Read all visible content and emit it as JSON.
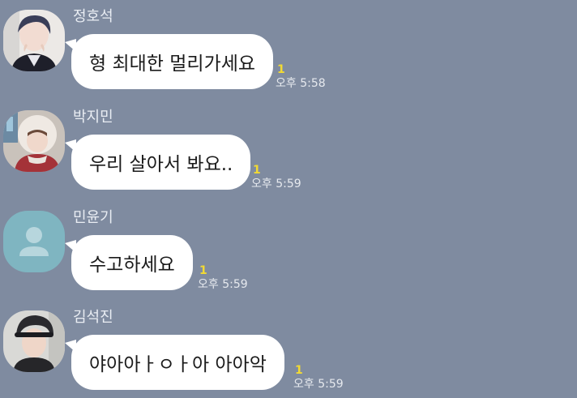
{
  "messages": [
    {
      "sender": "정호석",
      "text": "형 최대한 멀리가세요",
      "unread": "1",
      "time": "오후 5:58",
      "avatar": "profile-photo"
    },
    {
      "sender": "박지민",
      "text": "우리 살아서 봐요..",
      "unread": "1",
      "time": "오후 5:59",
      "avatar": "profile-photo"
    },
    {
      "sender": "민윤기",
      "text": "수고하세요",
      "unread": "1",
      "time": "오후 5:59",
      "avatar": "default-avatar"
    },
    {
      "sender": "김석진",
      "text": "야아아ㅏㅇㅏ아 아아악",
      "unread": "1",
      "time": "오후 5:59",
      "avatar": "profile-photo"
    }
  ],
  "colors": {
    "background": "#7f8ba0",
    "bubble": "#ffffff",
    "unread": "#f2da33",
    "default_avatar": "#7fb5c1"
  }
}
